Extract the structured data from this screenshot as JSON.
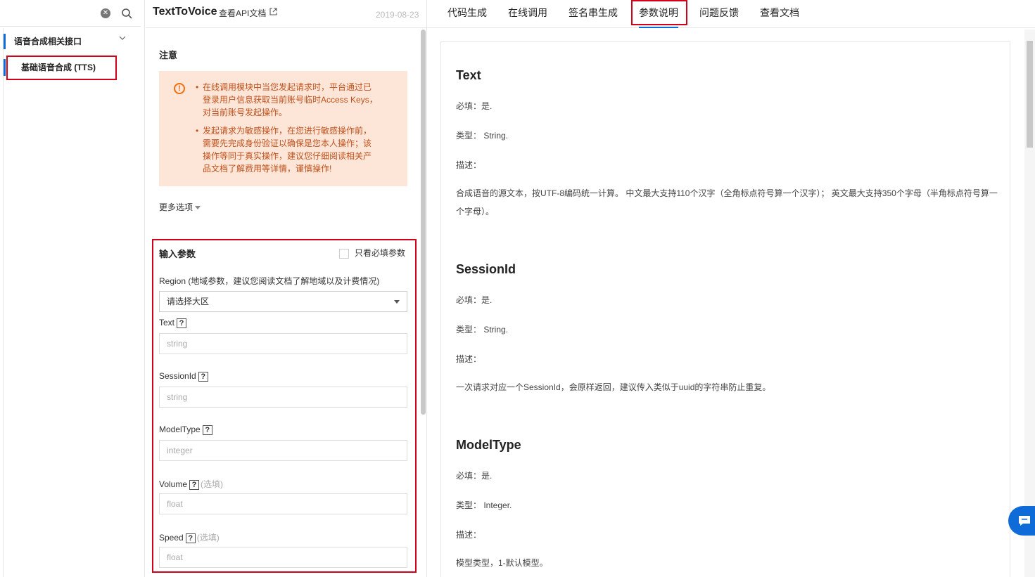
{
  "sidebar": {
    "group_label": "语音合成相关接口",
    "item_label": "基础语音合成 (TTS)"
  },
  "header": {
    "api_title": "TextToVoice",
    "doc_link": "查看API文档",
    "date": "2019-08-23"
  },
  "notice": {
    "title": "注意",
    "items": [
      "在线调用模块中当您发起请求时，平台通过已登录用户信息获取当前账号临时Access Keys，对当前账号发起操作。",
      "发起请求为敏感操作，在您进行敏感操作前，需要先完成身份验证以确保是您本人操作；该操作等同于真实操作，建议您仔细阅读相关产品文档了解费用等详情，谨慎操作!"
    ]
  },
  "more_options": "更多选项",
  "input_params": {
    "title": "输入参数",
    "required_only": "只看必填参数",
    "region_label": "Region (地域参数，建议您阅读文档了解地域以及计费情况)",
    "region_value": "请选择大区",
    "fields": [
      {
        "label": "Text",
        "optional": "",
        "placeholder": "string"
      },
      {
        "label": "SessionId",
        "optional": "",
        "placeholder": "string"
      },
      {
        "label": "ModelType",
        "optional": "",
        "placeholder": "integer"
      },
      {
        "label": "Volume",
        "optional": "(选填)",
        "placeholder": "float"
      },
      {
        "label": "Speed",
        "optional": "(选填)",
        "placeholder": "float"
      }
    ]
  },
  "tabs": [
    "代码生成",
    "在线调用",
    "签名串生成",
    "参数说明",
    "问题反馈",
    "查看文档"
  ],
  "doc": {
    "params": [
      {
        "name": "Text",
        "required": "必填：是.",
        "type": "类型： String.",
        "desc_label": "描述：",
        "desc": "合成语音的源文本，按UTF-8编码统一计算。 中文最大支持110个汉字（全角标点符号算一个汉字）； 英文最大支持350个字母（半角标点符号算一个字母）。"
      },
      {
        "name": "SessionId",
        "required": "必填：是.",
        "type": "类型： String.",
        "desc_label": "描述：",
        "desc": "一次请求对应一个SessionId，会原样返回，建议传入类似于uuid的字符串防止重复。"
      },
      {
        "name": "ModelType",
        "required": "必填：是.",
        "type": "类型： Integer.",
        "desc_label": "描述：",
        "desc": "模型类型，1-默认模型。"
      }
    ]
  },
  "colors": {
    "accent": "#0f6bd8",
    "highlight_box": "#d0021b",
    "notice_bg": "#fde6d8",
    "notice_text": "#c0511c"
  }
}
